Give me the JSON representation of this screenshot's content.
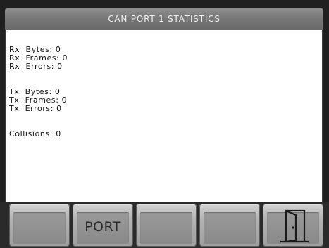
{
  "header": {
    "title": "CAN PORT 1 STATISTICS"
  },
  "stats": {
    "rx": [
      {
        "text": "Rx  Bytes: 0"
      },
      {
        "text": "Rx  Frames: 0"
      },
      {
        "text": "Rx  Errors: 0"
      }
    ],
    "tx": [
      {
        "text": "Tx  Bytes: 0"
      },
      {
        "text": "Tx  Frames: 0"
      },
      {
        "text": "Tx  Errors: 0"
      }
    ],
    "collisions": {
      "text": "Collisions: 0"
    }
  },
  "softkeys": [
    {
      "label": ""
    },
    {
      "label": "PORT"
    },
    {
      "label": ""
    },
    {
      "label": ""
    },
    {
      "label": "",
      "icon": "exit-door-icon"
    }
  ]
}
